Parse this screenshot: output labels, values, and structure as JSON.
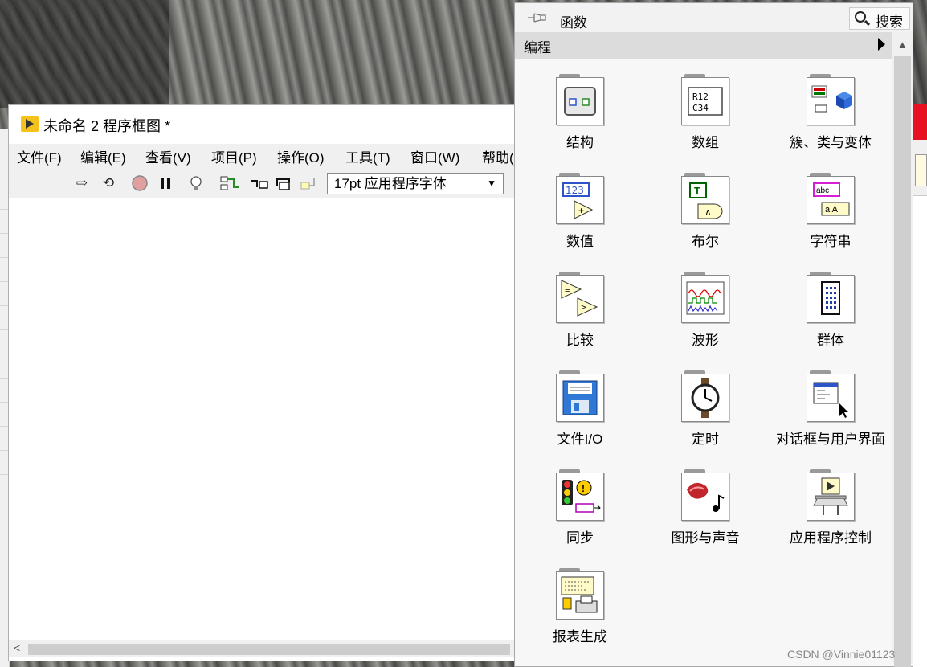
{
  "block_diagram": {
    "title": "未命名 2 程序框图 *",
    "menu": [
      "文件(F)",
      "编辑(E)",
      "查看(V)",
      "项目(P)",
      "操作(O)",
      "工具(T)",
      "窗口(W)",
      "帮助("
    ],
    "toolbar": {
      "icons": [
        "run-arrow-icon",
        "run-continuously-icon",
        "abort-icon",
        "pause-icon",
        "highlight-execution-icon",
        "retain-wire-values-icon",
        "step-into-icon",
        "step-over-icon",
        "step-out-icon"
      ],
      "font_value": "17pt 应用程序字体"
    }
  },
  "palette": {
    "title": "函数",
    "search_label": "搜索",
    "category": "编程",
    "items": [
      {
        "label": "结构",
        "icon": "structures-icon"
      },
      {
        "label": "数组",
        "icon": "array-icon"
      },
      {
        "label": "簇、类与变体",
        "icon": "cluster-class-variant-icon"
      },
      {
        "label": "数值",
        "icon": "numeric-icon"
      },
      {
        "label": "布尔",
        "icon": "boolean-icon"
      },
      {
        "label": "字符串",
        "icon": "string-icon"
      },
      {
        "label": "比较",
        "icon": "comparison-icon"
      },
      {
        "label": "波形",
        "icon": "waveform-icon"
      },
      {
        "label": "群体",
        "icon": "collections-icon"
      },
      {
        "label": "文件I/O",
        "icon": "file-io-icon"
      },
      {
        "label": "定时",
        "icon": "timing-icon"
      },
      {
        "label": "对话框与用户界面",
        "icon": "dialog-ui-icon"
      },
      {
        "label": "同步",
        "icon": "synchronization-icon"
      },
      {
        "label": "图形与声音",
        "icon": "graphics-sound-icon"
      },
      {
        "label": "应用程序控制",
        "icon": "application-control-icon"
      },
      {
        "label": "报表生成",
        "icon": "report-generation-icon"
      }
    ]
  },
  "watermark": "CSDN @Vinnie01123"
}
